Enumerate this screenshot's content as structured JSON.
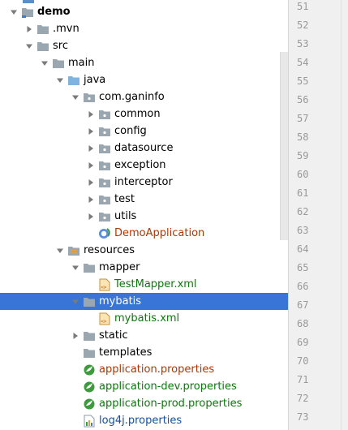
{
  "tree": {
    "rows": [
      {
        "label": "demo",
        "style": "bold",
        "icon": "module-folder-icon",
        "chev": "down",
        "level": 0
      },
      {
        "label": ".mvn",
        "style": "",
        "icon": "folder-icon",
        "chev": "right",
        "level": 1
      },
      {
        "label": "src",
        "style": "",
        "icon": "folder-icon",
        "chev": "down",
        "level": 1
      },
      {
        "label": "main",
        "style": "",
        "icon": "folder-icon",
        "chev": "down",
        "level": 2
      },
      {
        "label": "java",
        "style": "",
        "icon": "source-folder-icon",
        "chev": "down",
        "level": 3
      },
      {
        "label": "com.ganinfo",
        "style": "",
        "icon": "package-icon",
        "chev": "down",
        "level": 4
      },
      {
        "label": "common",
        "style": "",
        "icon": "package-icon",
        "chev": "right",
        "level": 5
      },
      {
        "label": "config",
        "style": "",
        "icon": "package-icon",
        "chev": "right",
        "level": 5
      },
      {
        "label": "datasource",
        "style": "",
        "icon": "package-icon",
        "chev": "right",
        "level": 5
      },
      {
        "label": "exception",
        "style": "",
        "icon": "package-icon",
        "chev": "right",
        "level": 5
      },
      {
        "label": "interceptor",
        "style": "",
        "icon": "package-icon",
        "chev": "right",
        "level": 5
      },
      {
        "label": "test",
        "style": "",
        "icon": "package-icon",
        "chev": "right",
        "level": 5
      },
      {
        "label": "utils",
        "style": "",
        "icon": "package-icon",
        "chev": "right",
        "level": 5
      },
      {
        "label": "DemoApplication",
        "style": "orange",
        "icon": "spring-class-icon",
        "chev": "none",
        "level": 5
      },
      {
        "label": "resources",
        "style": "",
        "icon": "resources-folder-icon",
        "chev": "down",
        "level": 3
      },
      {
        "label": "mapper",
        "style": "",
        "icon": "folder-icon",
        "chev": "down",
        "level": 4
      },
      {
        "label": "TestMapper.xml",
        "style": "green",
        "icon": "xml-file-icon",
        "chev": "none",
        "level": 5
      },
      {
        "label": "mybatis",
        "style": "",
        "icon": "folder-icon",
        "chev": "down",
        "level": 4,
        "selected": true
      },
      {
        "label": "mybatis.xml",
        "style": "green",
        "icon": "xml-file-icon",
        "chev": "none",
        "level": 5
      },
      {
        "label": "static",
        "style": "",
        "icon": "folder-icon",
        "chev": "right",
        "level": 4
      },
      {
        "label": "templates",
        "style": "",
        "icon": "folder-icon",
        "chev": "none",
        "level": 4
      },
      {
        "label": "application.properties",
        "style": "orange",
        "icon": "spring-properties-icon",
        "chev": "none",
        "level": 4
      },
      {
        "label": "application-dev.properties",
        "style": "green",
        "icon": "spring-properties-icon",
        "chev": "none",
        "level": 4
      },
      {
        "label": "application-prod.properties",
        "style": "green",
        "icon": "spring-properties-icon",
        "chev": "none",
        "level": 4
      },
      {
        "label": "log4j.properties",
        "style": "blue",
        "icon": "properties-file-icon",
        "chev": "none",
        "level": 4
      }
    ]
  },
  "gutter": {
    "line_numbers": [
      "51",
      "52",
      "53",
      "54",
      "55",
      "56",
      "57",
      "58",
      "59",
      "60",
      "61",
      "62",
      "63",
      "64",
      "65",
      "66",
      "67",
      "68",
      "69",
      "70",
      "71",
      "72",
      "73"
    ]
  },
  "colors": {
    "selection": "#3875d7",
    "folder": "#9aa7b0",
    "source_folder": "#7fb3e0",
    "spring": "#3d9a3d",
    "xml": "#e8a33c"
  }
}
